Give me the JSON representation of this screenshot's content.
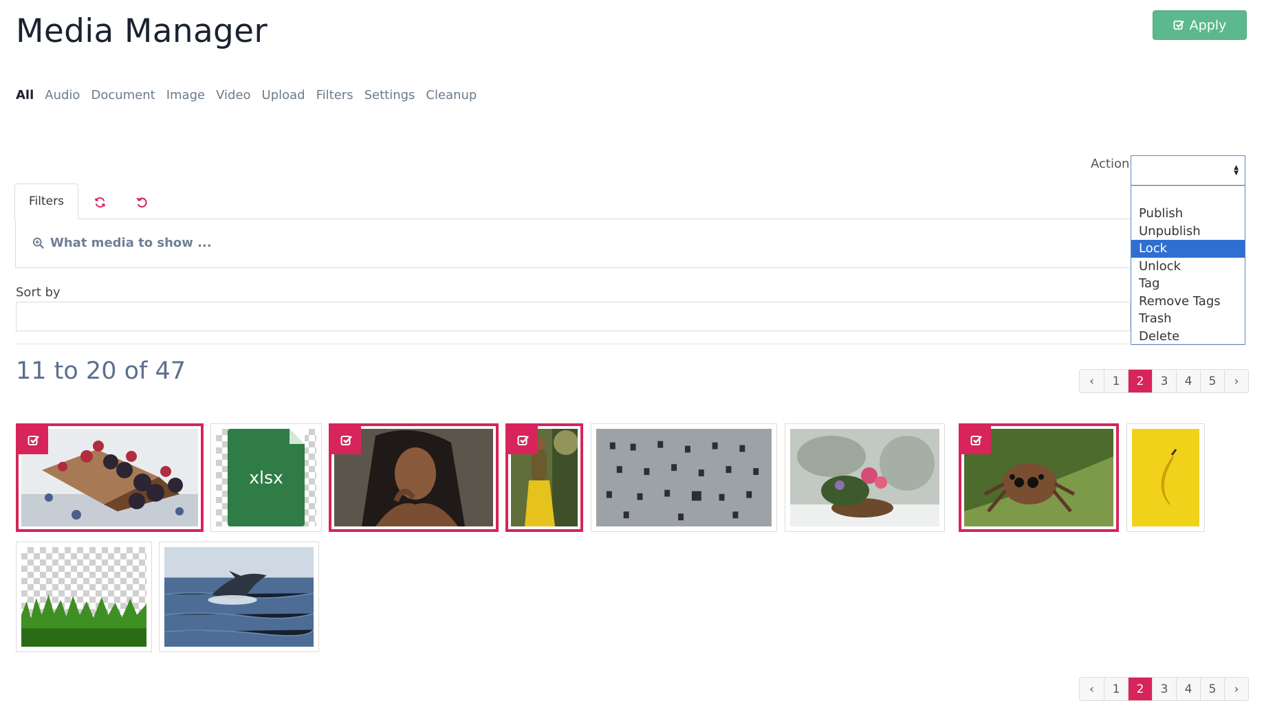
{
  "title": "Media Manager",
  "apply_label": "Apply",
  "nav": [
    "All",
    "Audio",
    "Document",
    "Image",
    "Video",
    "Upload",
    "Filters",
    "Settings",
    "Cleanup"
  ],
  "nav_active": "All",
  "action": {
    "label": "Action",
    "selected": "",
    "options": [
      "Publish",
      "Unpublish",
      "Lock",
      "Unlock",
      "Tag",
      "Remove Tags",
      "Trash",
      "Delete"
    ],
    "highlighted": "Lock"
  },
  "filters": {
    "tab_label": "Filters",
    "prompt": "What media to show ..."
  },
  "sort": {
    "label": "Sort by",
    "value": ""
  },
  "count_text": "11 to 20 of 47",
  "pagination": {
    "prev": "‹",
    "next": "›",
    "pages": [
      "1",
      "2",
      "3",
      "4",
      "5"
    ],
    "current": "2"
  },
  "media": [
    {
      "name": "dessert-berries-image",
      "type": "image",
      "selected": true
    },
    {
      "name": "xlsx-document",
      "type": "document",
      "label": "xlsx",
      "selected": false
    },
    {
      "name": "woman-portrait-image",
      "type": "image",
      "selected": true
    },
    {
      "name": "woman-yellow-dress-image",
      "type": "image",
      "selected": true
    },
    {
      "name": "concrete-building-image",
      "type": "image",
      "selected": false
    },
    {
      "name": "flower-basket-snow-image",
      "type": "image",
      "selected": false
    },
    {
      "name": "jumping-spider-image",
      "type": "image",
      "selected": true
    },
    {
      "name": "banana-yellow-image",
      "type": "image",
      "selected": false
    },
    {
      "name": "grass-transparent-image",
      "type": "image",
      "selected": false
    },
    {
      "name": "whale-breaching-image",
      "type": "image",
      "selected": false
    }
  ],
  "colors": {
    "accent": "#d7245a",
    "apply": "#5cb88d",
    "select_highlight": "#2e6fd1"
  }
}
